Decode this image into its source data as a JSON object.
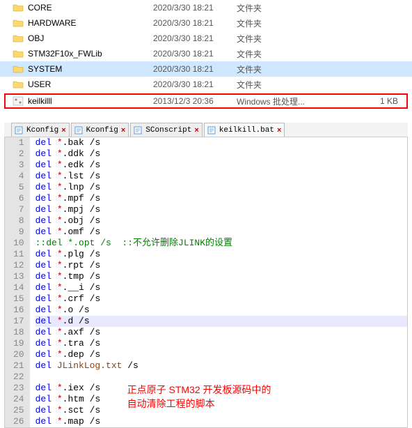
{
  "files": [
    {
      "name": "CORE",
      "date": "2020/3/30 18:21",
      "type": "文件夹",
      "size": "",
      "icon": "folder"
    },
    {
      "name": "HARDWARE",
      "date": "2020/3/30 18:21",
      "type": "文件夹",
      "size": "",
      "icon": "folder"
    },
    {
      "name": "OBJ",
      "date": "2020/3/30 18:21",
      "type": "文件夹",
      "size": "",
      "icon": "folder"
    },
    {
      "name": "STM32F10x_FWLib",
      "date": "2020/3/30 18:21",
      "type": "文件夹",
      "size": "",
      "icon": "folder"
    },
    {
      "name": "SYSTEM",
      "date": "2020/3/30 18:21",
      "type": "文件夹",
      "size": "",
      "icon": "folder",
      "selected": true
    },
    {
      "name": "USER",
      "date": "2020/3/30 18:21",
      "type": "文件夹",
      "size": "",
      "icon": "folder"
    },
    {
      "name": "keilkilll",
      "date": "2013/12/3 20:36",
      "type": "Windows 批处理...",
      "size": "1 KB",
      "icon": "bat",
      "highlighted": true
    }
  ],
  "tabs": [
    {
      "label": "Kconfig",
      "active": false
    },
    {
      "label": "Kconfig",
      "active": false
    },
    {
      "label": "SConscript",
      "active": false
    },
    {
      "label": "keilkill.bat",
      "active": true
    }
  ],
  "code": [
    {
      "n": 1,
      "kw": "del",
      "wild": "*",
      "rest": ".bak /s"
    },
    {
      "n": 2,
      "kw": "del",
      "wild": "*",
      "rest": ".ddk /s"
    },
    {
      "n": 3,
      "kw": "del",
      "wild": "*",
      "rest": ".edk /s"
    },
    {
      "n": 4,
      "kw": "del",
      "wild": "*",
      "rest": ".lst /s"
    },
    {
      "n": 5,
      "kw": "del",
      "wild": "*",
      "rest": ".lnp /s"
    },
    {
      "n": 6,
      "kw": "del",
      "wild": "*",
      "rest": ".mpf /s"
    },
    {
      "n": 7,
      "kw": "del",
      "wild": "*",
      "rest": ".mpj /s"
    },
    {
      "n": 8,
      "kw": "del",
      "wild": "*",
      "rest": ".obj /s"
    },
    {
      "n": 9,
      "kw": "del",
      "wild": "*",
      "rest": ".omf /s"
    },
    {
      "n": 10,
      "comment": "::del *.opt /s  ::不允许删除JLINK的设置"
    },
    {
      "n": 11,
      "kw": "del",
      "wild": "*",
      "rest": ".plg /s"
    },
    {
      "n": 12,
      "kw": "del",
      "wild": "*",
      "rest": ".rpt /s"
    },
    {
      "n": 13,
      "kw": "del",
      "wild": "*",
      "rest": ".tmp /s"
    },
    {
      "n": 14,
      "kw": "del",
      "wild": "*",
      "rest": ".__i /s"
    },
    {
      "n": 15,
      "kw": "del",
      "wild": "*",
      "rest": ".crf /s"
    },
    {
      "n": 16,
      "kw": "del",
      "wild": "*",
      "rest": ".o /s"
    },
    {
      "n": 17,
      "kw": "del",
      "wild": "*",
      "rest": ".d /s",
      "current": true
    },
    {
      "n": 18,
      "kw": "del",
      "wild": "*",
      "rest": ".axf /s"
    },
    {
      "n": 19,
      "kw": "del",
      "wild": "*",
      "rest": ".tra /s"
    },
    {
      "n": 20,
      "kw": "del",
      "wild": "*",
      "rest": ".dep /s"
    },
    {
      "n": 21,
      "kw": "del",
      "func": "JLinkLog.txt",
      "rest2": " /s"
    },
    {
      "n": 22,
      "empty": true
    },
    {
      "n": 23,
      "kw": "del",
      "wild": "*",
      "rest": ".iex /s"
    },
    {
      "n": 24,
      "kw": "del",
      "wild": "*",
      "rest": ".htm /s"
    },
    {
      "n": 25,
      "kw": "del",
      "wild": "*",
      "rest": ".sct /s"
    },
    {
      "n": 26,
      "kw": "del",
      "wild": "*",
      "rest": ".map /s"
    }
  ],
  "annotation": {
    "line1": "正点原子 STM32 开发板源码中的",
    "line2": "自动清除工程的脚本"
  }
}
